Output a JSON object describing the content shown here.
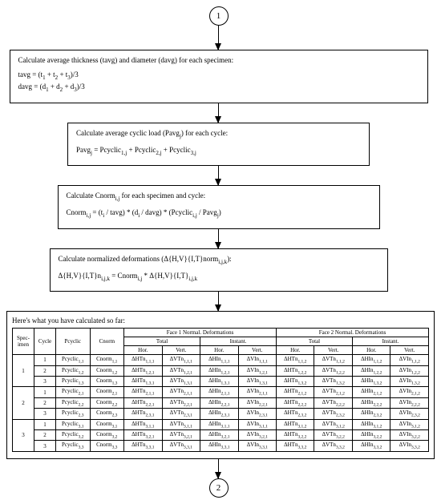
{
  "connectors": {
    "top": "1",
    "bottom": "2"
  },
  "step1": {
    "title": "Calculate average thickness (tavg) and diameter (davg) for each specimen:",
    "line1_html": "tavg = (t<span class=\"sub\">1</span> + t<span class=\"sub\">2</span> + t<span class=\"sub\">3</span>)/3",
    "line2_html": "davg = (d<span class=\"sub\">1</span> + d<span class=\"sub\">2</span> + d<span class=\"sub\">3</span>)/3"
  },
  "step2": {
    "title_html": "Calculate average cyclic load (Pavg<span class=\"sub\">j</span>) for each cycle:",
    "line1_html": "Pavg<span class=\"sub\">j</span> = Pcyclic<span class=\"sub\">1,j</span> + Pcyclic<span class=\"sub\">2,j</span> + Pcyclic<span class=\"sub\">3,j</span>"
  },
  "step3": {
    "title_html": "Calculate Cnorm<span class=\"sub\">i,j</span> for each specimen and cycle:",
    "line1_html": "Cnorm<span class=\"sub\">i,j</span> = (t<span class=\"sub\">i</span> / tavg) * (d<span class=\"sub\">i</span> / davg) * (Pcyclic<span class=\"sub\">i,j</span> / Pavg<span class=\"sub\">j</span>)"
  },
  "step4": {
    "title_html": "Calculate normalized deformations (Δ{H,V}{I,T}norm<span class=\"sub\">i,j,k</span>):",
    "line1_html": "Δ{H,V}{I,T}n<span class=\"sub\">i,j,k</span> = Cnorm<span class=\"sub\">i,j</span> * Δ{H,V}{I,T}<span class=\"sub\">i,j,k</span>"
  },
  "summary_intro": "Here's what you have calculated so far:",
  "table": {
    "head": {
      "specimen": "Spec-imen",
      "cycle": "Cycle",
      "pcyclic": "Pcyclic",
      "cnorm": "Cnorm",
      "face1": "Face 1 Normal. Deformations",
      "face2": "Face 2 Normal. Deformations",
      "total": "Total",
      "instant": "Instant.",
      "hor": "Hor.",
      "vert": "Vert."
    },
    "rows": [
      {
        "specimen": "1",
        "cycle": "1",
        "pcyc_html": "Pcyclic<span class=\"sub\">1,1</span>",
        "cn_html": "Cnorm<span class=\"sub\">1,1</span>",
        "cells_html": [
          "ΔHTn<span class=\"sub\">1,1,1</span>",
          "ΔVTn<span class=\"sub\">1,1,1</span>",
          "ΔHIn<span class=\"sub\">1,1,1</span>",
          "ΔVIn<span class=\"sub\">1,1,1</span>",
          "ΔHTn<span class=\"sub\">1,1,2</span>",
          "ΔVTn<span class=\"sub\">1,1,2</span>",
          "ΔHIn<span class=\"sub\">1,1,2</span>",
          "ΔVIn<span class=\"sub\">1,1,2</span>"
        ]
      },
      {
        "specimen": "",
        "cycle": "2",
        "pcyc_html": "Pcyclic<span class=\"sub\">1,2</span>",
        "cn_html": "Cnorm<span class=\"sub\">1,2</span>",
        "cells_html": [
          "ΔHTn<span class=\"sub\">1,2,1</span>",
          "ΔVTn<span class=\"sub\">1,2,1</span>",
          "ΔHIn<span class=\"sub\">1,2,1</span>",
          "ΔVIn<span class=\"sub\">1,2,1</span>",
          "ΔHTn<span class=\"sub\">1,2,2</span>",
          "ΔVTn<span class=\"sub\">1,2,2</span>",
          "ΔHIn<span class=\"sub\">1,2,2</span>",
          "ΔVIn<span class=\"sub\">1,2,2</span>"
        ]
      },
      {
        "specimen": "",
        "cycle": "3",
        "pcyc_html": "Pcyclic<span class=\"sub\">1,3</span>",
        "cn_html": "Cnorm<span class=\"sub\">1,3</span>",
        "cells_html": [
          "ΔHTn<span class=\"sub\">1,3,1</span>",
          "ΔVTn<span class=\"sub\">1,3,1</span>",
          "ΔHIn<span class=\"sub\">1,3,1</span>",
          "ΔVIn<span class=\"sub\">1,3,1</span>",
          "ΔHTn<span class=\"sub\">1,3,2</span>",
          "ΔVTn<span class=\"sub\">1,3,2</span>",
          "ΔHIn<span class=\"sub\">1,3,2</span>",
          "ΔVIn<span class=\"sub\">1,3,2</span>"
        ]
      },
      {
        "specimen": "2",
        "cycle": "1",
        "pcyc_html": "Pcyclic<span class=\"sub\">2,1</span>",
        "cn_html": "Cnorm<span class=\"sub\">2,1</span>",
        "cells_html": [
          "ΔHTn<span class=\"sub\">2,1,1</span>",
          "ΔVTn<span class=\"sub\">2,1,1</span>",
          "ΔHIn<span class=\"sub\">2,1,1</span>",
          "ΔVIn<span class=\"sub\">2,1,1</span>",
          "ΔHTn<span class=\"sub\">2,1,2</span>",
          "ΔVTn<span class=\"sub\">2,1,2</span>",
          "ΔHIn<span class=\"sub\">2,1,2</span>",
          "ΔVIn<span class=\"sub\">2,1,2</span>"
        ]
      },
      {
        "specimen": "",
        "cycle": "2",
        "pcyc_html": "Pcyclic<span class=\"sub\">2,2</span>",
        "cn_html": "Cnorm<span class=\"sub\">2,2</span>",
        "cells_html": [
          "ΔHTn<span class=\"sub\">2,2,1</span>",
          "ΔVTn<span class=\"sub\">2,2,1</span>",
          "ΔHIn<span class=\"sub\">2,2,1</span>",
          "ΔVIn<span class=\"sub\">2,2,1</span>",
          "ΔHTn<span class=\"sub\">2,2,2</span>",
          "ΔVTn<span class=\"sub\">2,2,2</span>",
          "ΔHIn<span class=\"sub\">2,2,2</span>",
          "ΔVIn<span class=\"sub\">2,2,2</span>"
        ]
      },
      {
        "specimen": "",
        "cycle": "3",
        "pcyc_html": "Pcyclic<span class=\"sub\">2,3</span>",
        "cn_html": "Cnorm<span class=\"sub\">2,3</span>",
        "cells_html": [
          "ΔHTn<span class=\"sub\">2,3,1</span>",
          "ΔVTn<span class=\"sub\">2,3,1</span>",
          "ΔHIn<span class=\"sub\">2,3,1</span>",
          "ΔVIn<span class=\"sub\">2,3,1</span>",
          "ΔHTn<span class=\"sub\">2,3,2</span>",
          "ΔVTn<span class=\"sub\">2,3,2</span>",
          "ΔHIn<span class=\"sub\">2,3,2</span>",
          "ΔVIn<span class=\"sub\">2,3,2</span>"
        ]
      },
      {
        "specimen": "3",
        "cycle": "1",
        "pcyc_html": "Pcyclic<span class=\"sub\">3,1</span>",
        "cn_html": "Cnorm<span class=\"sub\">3,1</span>",
        "cells_html": [
          "ΔHTn<span class=\"sub\">3,1,1</span>",
          "ΔVTn<span class=\"sub\">3,1,1</span>",
          "ΔHIn<span class=\"sub\">3,1,1</span>",
          "ΔVIn<span class=\"sub\">3,1,1</span>",
          "ΔHTn<span class=\"sub\">3,1,2</span>",
          "ΔVTn<span class=\"sub\">3,1,2</span>",
          "ΔHIn<span class=\"sub\">3,1,2</span>",
          "ΔVIn<span class=\"sub\">3,1,2</span>"
        ]
      },
      {
        "specimen": "",
        "cycle": "2",
        "pcyc_html": "Pcyclic<span class=\"sub\">3,2</span>",
        "cn_html": "Cnorm<span class=\"sub\">3,2</span>",
        "cells_html": [
          "ΔHTn<span class=\"sub\">3,2,1</span>",
          "ΔVTn<span class=\"sub\">3,2,1</span>",
          "ΔHIn<span class=\"sub\">3,2,1</span>",
          "ΔVIn<span class=\"sub\">3,2,1</span>",
          "ΔHTn<span class=\"sub\">3,2,2</span>",
          "ΔVTn<span class=\"sub\">3,2,2</span>",
          "ΔHIn<span class=\"sub\">3,2,2</span>",
          "ΔVIn<span class=\"sub\">3,2,2</span>"
        ]
      },
      {
        "specimen": "",
        "cycle": "3",
        "pcyc_html": "Pcyclic<span class=\"sub\">3,3</span>",
        "cn_html": "Cnorm<span class=\"sub\">3,3</span>",
        "cells_html": [
          "ΔHTn<span class=\"sub\">3,3,1</span>",
          "ΔVTn<span class=\"sub\">3,3,1</span>",
          "ΔHIn<span class=\"sub\">3,3,1</span>",
          "ΔVIn<span class=\"sub\">3,3,1</span>",
          "ΔHTn<span class=\"sub\">3,3,2</span>",
          "ΔVTn<span class=\"sub\">3,3,2</span>",
          "ΔHIn<span class=\"sub\">3,3,2</span>",
          "ΔVIn<span class=\"sub\">3,3,2</span>"
        ]
      }
    ]
  }
}
